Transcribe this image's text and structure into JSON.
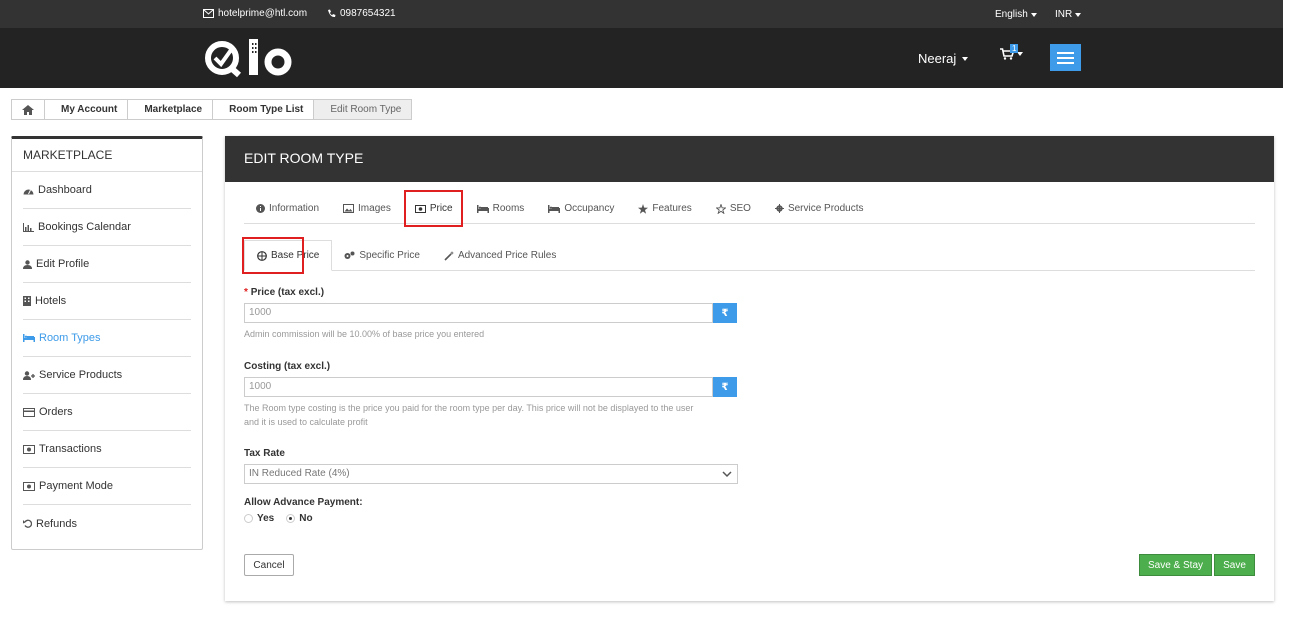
{
  "topbar": {
    "email": "hotelprime@htl.com",
    "phone": "0987654321",
    "language": "English",
    "currency": "INR"
  },
  "header": {
    "logo_text": "Qlo",
    "user_name": "Neeraj",
    "cart_count": "1"
  },
  "breadcrumb": [
    "My Account",
    "Marketplace",
    "Room Type List",
    "Edit Room Type"
  ],
  "sidebar": {
    "title": "MARKETPLACE",
    "items": [
      {
        "label": "Dashboard",
        "icon": "dashboard-icon"
      },
      {
        "label": "Bookings Calendar",
        "icon": "bar-chart-icon"
      },
      {
        "label": "Edit Profile",
        "icon": "user-icon"
      },
      {
        "label": "Hotels",
        "icon": "building-icon"
      },
      {
        "label": "Room Types",
        "icon": "bed-icon",
        "active": true
      },
      {
        "label": "Service Products",
        "icon": "user-plus-icon"
      },
      {
        "label": "Orders",
        "icon": "credit-card-icon"
      },
      {
        "label": "Transactions",
        "icon": "money-icon"
      },
      {
        "label": "Payment Mode",
        "icon": "money-icon"
      },
      {
        "label": "Refunds",
        "icon": "undo-icon"
      }
    ]
  },
  "panel": {
    "title": "EDIT ROOM TYPE",
    "tabs": [
      "Information",
      "Images",
      "Price",
      "Rooms",
      "Occupancy",
      "Features",
      "SEO",
      "Service Products"
    ],
    "active_tab": "Price",
    "subtabs": [
      "Base Price",
      "Specific Price",
      "Advanced Price Rules"
    ],
    "active_subtab": "Base Price"
  },
  "form": {
    "price_label": "Price (tax excl.)",
    "price_required_mark": "*",
    "price_value": "1000",
    "currency_symbol": "₹",
    "price_help": "Admin commission will be 10.00% of base price you entered",
    "costing_label": "Costing (tax excl.)",
    "costing_value": "1000",
    "costing_help_1": "The Room type costing is the price you paid for the room type per day. This price will not be displayed to the user",
    "costing_help_2": "and it is used to calculate profit",
    "tax_label": "Tax Rate",
    "tax_value": "IN Reduced Rate (4%)",
    "advance_label": "Allow Advance Payment:",
    "advance_yes": "Yes",
    "advance_no": "No",
    "advance_selected": "No"
  },
  "actions": {
    "cancel": "Cancel",
    "save_stay": "Save & Stay",
    "save": "Save"
  },
  "colors": {
    "accent": "#3d9be9",
    "dark": "#333333",
    "success": "#4cae4c",
    "highlight": "#e02020"
  }
}
